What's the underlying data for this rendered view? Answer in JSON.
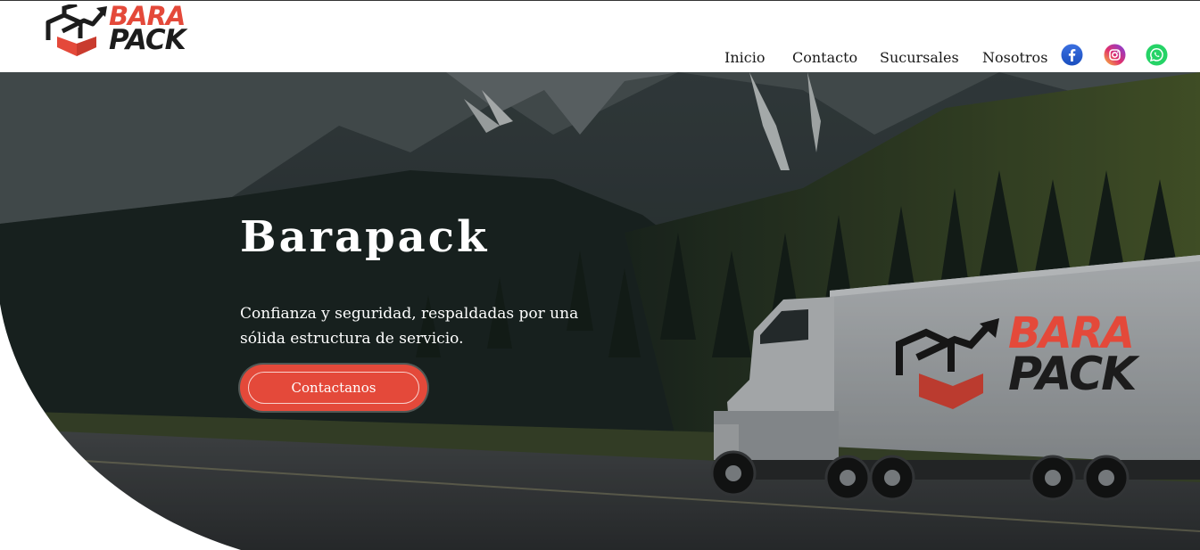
{
  "brand": {
    "logo_line1": "BARA",
    "logo_line2": "PACK",
    "accent_color": "#e4493a",
    "dark_color": "#1c1c1c"
  },
  "nav": {
    "items": [
      {
        "label": "Inicio"
      },
      {
        "label": "Contacto"
      },
      {
        "label": "Sucursales"
      },
      {
        "label": "Nosotros"
      }
    ],
    "social": [
      {
        "icon": "facebook-icon",
        "color": "#1877f2"
      },
      {
        "icon": "instagram-icon",
        "color": "#c13584"
      },
      {
        "icon": "whatsapp-icon",
        "color": "#25d366"
      }
    ]
  },
  "hero": {
    "title": "Barapack",
    "subtitle": "Confianza y seguridad, respaldadas por una sólida estructura de servicio.",
    "cta_label": "Contactanos",
    "truck_logo_line1": "BARA",
    "truck_logo_line2": "PACK"
  }
}
